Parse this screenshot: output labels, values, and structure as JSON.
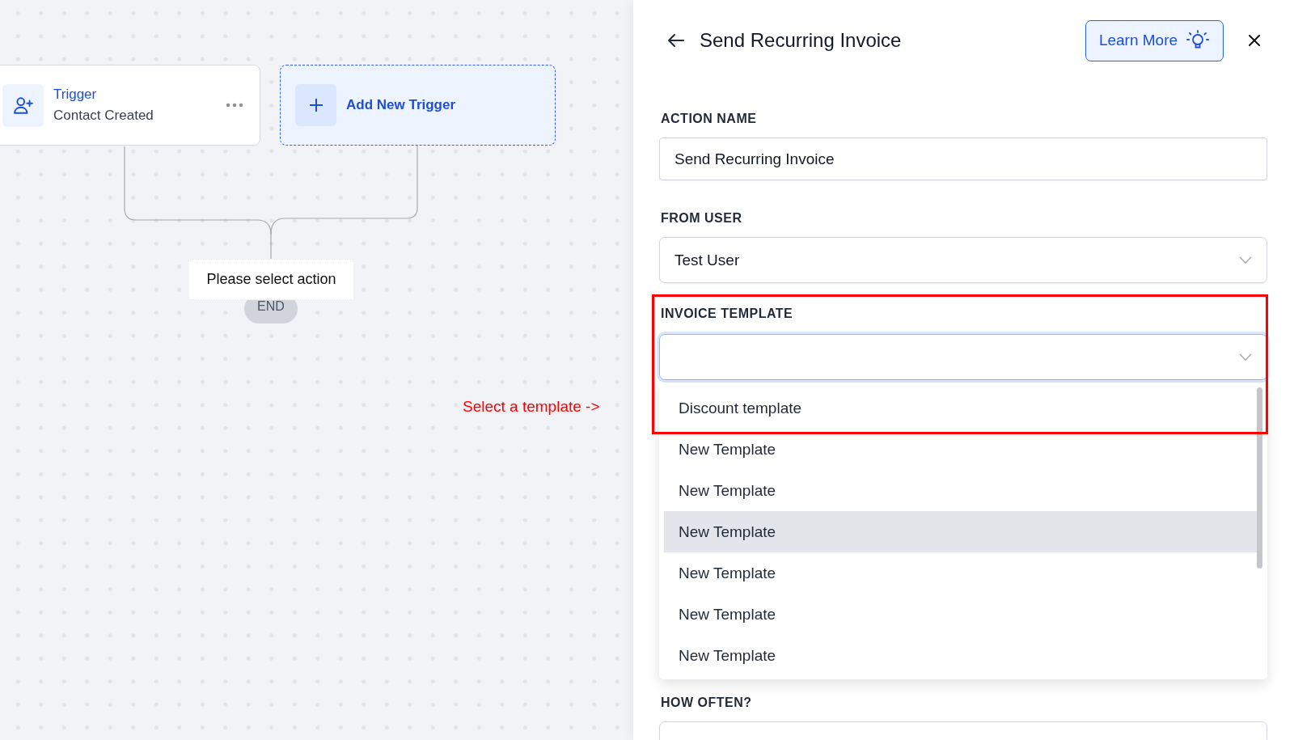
{
  "canvas": {
    "trigger_node": {
      "title": "Trigger",
      "subtitle": "Contact Created"
    },
    "add_trigger": {
      "label": "Add New Trigger"
    },
    "action_placeholder": "Please select action",
    "end_label": "END"
  },
  "annotation": {
    "text": "Select a template ->"
  },
  "panel": {
    "title": "Send Recurring Invoice",
    "learn_more": "Learn More",
    "fields": [
      {
        "kind": "text",
        "label": "ACTION NAME",
        "value": "Send Recurring Invoice"
      },
      {
        "kind": "select",
        "label": "FROM USER",
        "value": "Test User",
        "focused": false
      },
      {
        "kind": "select",
        "label": "INVOICE TEMPLATE",
        "focused": true,
        "open": true,
        "options": [
          {
            "label": "Discount template",
            "highlighted": false
          },
          {
            "label": "New Template",
            "highlighted": false
          },
          {
            "label": "New Template",
            "highlighted": false
          },
          {
            "label": "New Template",
            "highlighted": true
          },
          {
            "label": "New Template",
            "highlighted": false
          },
          {
            "label": "New Template",
            "highlighted": false
          },
          {
            "label": "New Template",
            "highlighted": false
          }
        ]
      },
      {
        "kind": "select",
        "label": "HOW OFTEN?",
        "focused": false
      }
    ]
  }
}
